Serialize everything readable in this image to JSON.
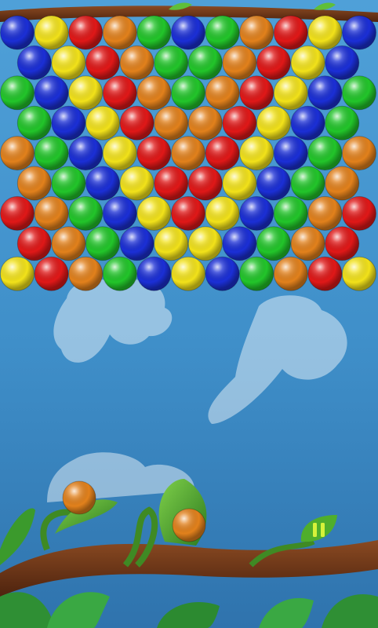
{
  "game": {
    "colors": {
      "blue": "#1b2fd6",
      "yellow": "#f2e21a",
      "red": "#e01818",
      "orange": "#e2811c",
      "green": "#22c52a",
      "sky": "#4fa0d8",
      "leaf": "#3f9a2a",
      "branch": "#6b3418",
      "pause": "#d6f23a"
    },
    "bubble_grid": [
      [
        "blue",
        "yellow",
        "red",
        "orange",
        "green",
        "blue",
        "green",
        "orange",
        "red",
        "yellow",
        "blue"
      ],
      [
        "blue",
        "yellow",
        "red",
        "orange",
        "green",
        "green",
        "orange",
        "red",
        "yellow",
        "blue"
      ],
      [
        "green",
        "blue",
        "yellow",
        "red",
        "orange",
        "green",
        "orange",
        "red",
        "yellow",
        "blue",
        "green"
      ],
      [
        "green",
        "blue",
        "yellow",
        "red",
        "orange",
        "orange",
        "red",
        "yellow",
        "blue",
        "green"
      ],
      [
        "orange",
        "green",
        "blue",
        "yellow",
        "red",
        "orange",
        "red",
        "yellow",
        "blue",
        "green",
        "orange"
      ],
      [
        "orange",
        "green",
        "blue",
        "yellow",
        "red",
        "red",
        "yellow",
        "blue",
        "green",
        "orange"
      ],
      [
        "red",
        "orange",
        "green",
        "blue",
        "yellow",
        "red",
        "yellow",
        "blue",
        "green",
        "orange",
        "red"
      ],
      [
        "red",
        "orange",
        "green",
        "blue",
        "yellow",
        "yellow",
        "blue",
        "green",
        "orange",
        "red"
      ],
      [
        "yellow",
        "red",
        "orange",
        "green",
        "blue",
        "yellow",
        "blue",
        "green",
        "orange",
        "red",
        "yellow"
      ]
    ],
    "current_bubble": "orange",
    "next_bubble": "orange",
    "pause_icon": "pause-icon"
  }
}
